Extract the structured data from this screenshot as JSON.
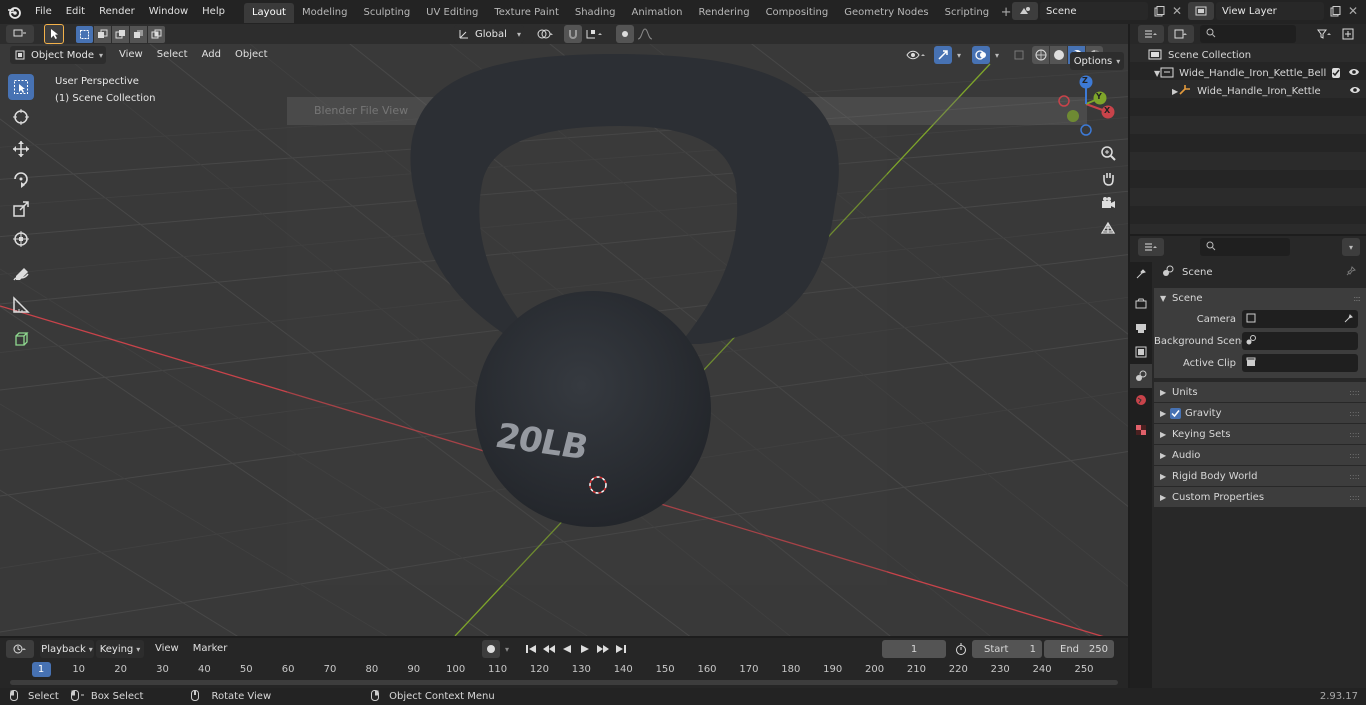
{
  "topbar": {
    "menus": [
      "File",
      "Edit",
      "Render",
      "Window",
      "Help"
    ],
    "workspaces": [
      "Layout",
      "Modeling",
      "Sculpting",
      "UV Editing",
      "Texture Paint",
      "Shading",
      "Animation",
      "Rendering",
      "Compositing",
      "Geometry Nodes",
      "Scripting"
    ],
    "active_workspace": "Layout",
    "scene_name": "Scene",
    "view_layer": "View Layer"
  },
  "viewport_header": {
    "mode": "Object Mode",
    "menus": [
      "View",
      "Select",
      "Add",
      "Object"
    ],
    "transform_orientation": "Global",
    "options_label": "Options"
  },
  "viewport": {
    "perspective_label": "User Perspective",
    "collection_label": "(1) Scene Collection",
    "engraving": "20LB",
    "ghost_dialog_title": "Blender File View",
    "gizmo_axes": [
      "X",
      "Y",
      "Z"
    ]
  },
  "outliner": {
    "root": "Scene Collection",
    "items": [
      {
        "label": "Wide_Handle_Iron_Kettle_Bell",
        "depth": 1
      },
      {
        "label": "Wide_Handle_Iron_Kettle",
        "depth": 2
      }
    ]
  },
  "properties": {
    "context": "Scene",
    "section": "Scene",
    "fields": [
      {
        "label": "Camera",
        "value": ""
      },
      {
        "label": "Background Scene",
        "value": ""
      },
      {
        "label": "Active Clip",
        "value": ""
      }
    ],
    "panels": [
      "Units",
      "Gravity",
      "Keying Sets",
      "Audio",
      "Rigid Body World",
      "Custom Properties"
    ],
    "gravity_checked": true
  },
  "timeline": {
    "menus": [
      "Playback",
      "Keying",
      "View",
      "Marker"
    ],
    "current_frame": "1",
    "start_label": "Start",
    "start": "1",
    "end_label": "End",
    "end": "250",
    "ruler": [
      "1",
      "10",
      "20",
      "30",
      "40",
      "50",
      "60",
      "70",
      "80",
      "90",
      "100",
      "110",
      "120",
      "130",
      "140",
      "150",
      "160",
      "170",
      "180",
      "190",
      "200",
      "210",
      "220",
      "230",
      "240",
      "250"
    ]
  },
  "statusbar": {
    "hints": [
      "Select",
      "Box Select",
      "Rotate View",
      "Object Context Menu"
    ],
    "version": "2.93.17"
  },
  "colors": {
    "accent": "#4772b3",
    "axis_x": "#c8434a",
    "axis_y": "#7ea52a",
    "axis_z": "#3d7ad6"
  }
}
